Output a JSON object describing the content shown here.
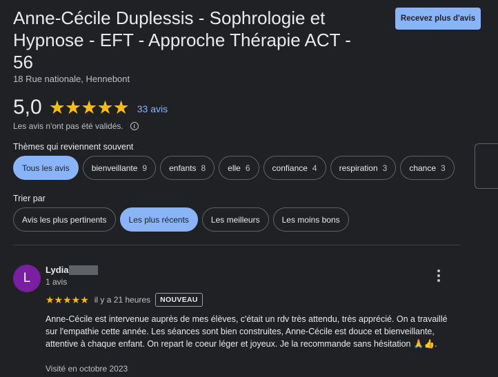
{
  "business": {
    "name": "Anne-Cécile Duplessis - Sophrologie et Hypnose - EFT - Approche Thérapie ACT - 56",
    "address": "18 Rue nationale, Hennebont",
    "cta_label": "Recevez plus d'avis"
  },
  "summary": {
    "rating": "5,0",
    "stars": "★★★★★",
    "review_count": "33 avis",
    "verification_note": "Les avis n'ont pas été validés.",
    "info_icon": "i"
  },
  "topics": {
    "label": "Thèmes qui reviennent souvent",
    "chips": [
      {
        "label": "Tous les avis",
        "count": "",
        "active": true
      },
      {
        "label": "bienveillante",
        "count": "9",
        "active": false
      },
      {
        "label": "enfants",
        "count": "8",
        "active": false
      },
      {
        "label": "elle",
        "count": "6",
        "active": false
      },
      {
        "label": "confiance",
        "count": "4",
        "active": false
      },
      {
        "label": "respiration",
        "count": "3",
        "active": false
      },
      {
        "label": "chance",
        "count": "3",
        "active": false
      }
    ]
  },
  "sort": {
    "label": "Trier par",
    "options": [
      {
        "label": "Avis les plus pertinents",
        "active": false
      },
      {
        "label": "Les plus récents",
        "active": true
      },
      {
        "label": "Les meilleurs",
        "active": false
      },
      {
        "label": "Les moins bons",
        "active": false
      }
    ]
  },
  "review": {
    "avatar_letter": "L",
    "avatar_color": "#7b1fa2",
    "author": "Lydia",
    "author_meta": "1 avis",
    "stars": "★★★★★",
    "time": "il y a 21 heures",
    "badge": "NOUVEAU",
    "text": "Anne-Cécile est intervenue auprès de mes élèves, c'était un rdv très attendu, très apprécié. On a travaillé sur l'empathie cette année. Les séances sont bien construites, Anne-Cécile est douce et bienveillante, attentive à chaque enfant. On repart le coeur léger et joyeux. Je la recommande sans hésitation 🙏👍.",
    "visit": "Visité en octobre 2023"
  },
  "colors": {
    "background": "#202124",
    "accent": "#8ab4f8",
    "star": "#fbbc04"
  }
}
